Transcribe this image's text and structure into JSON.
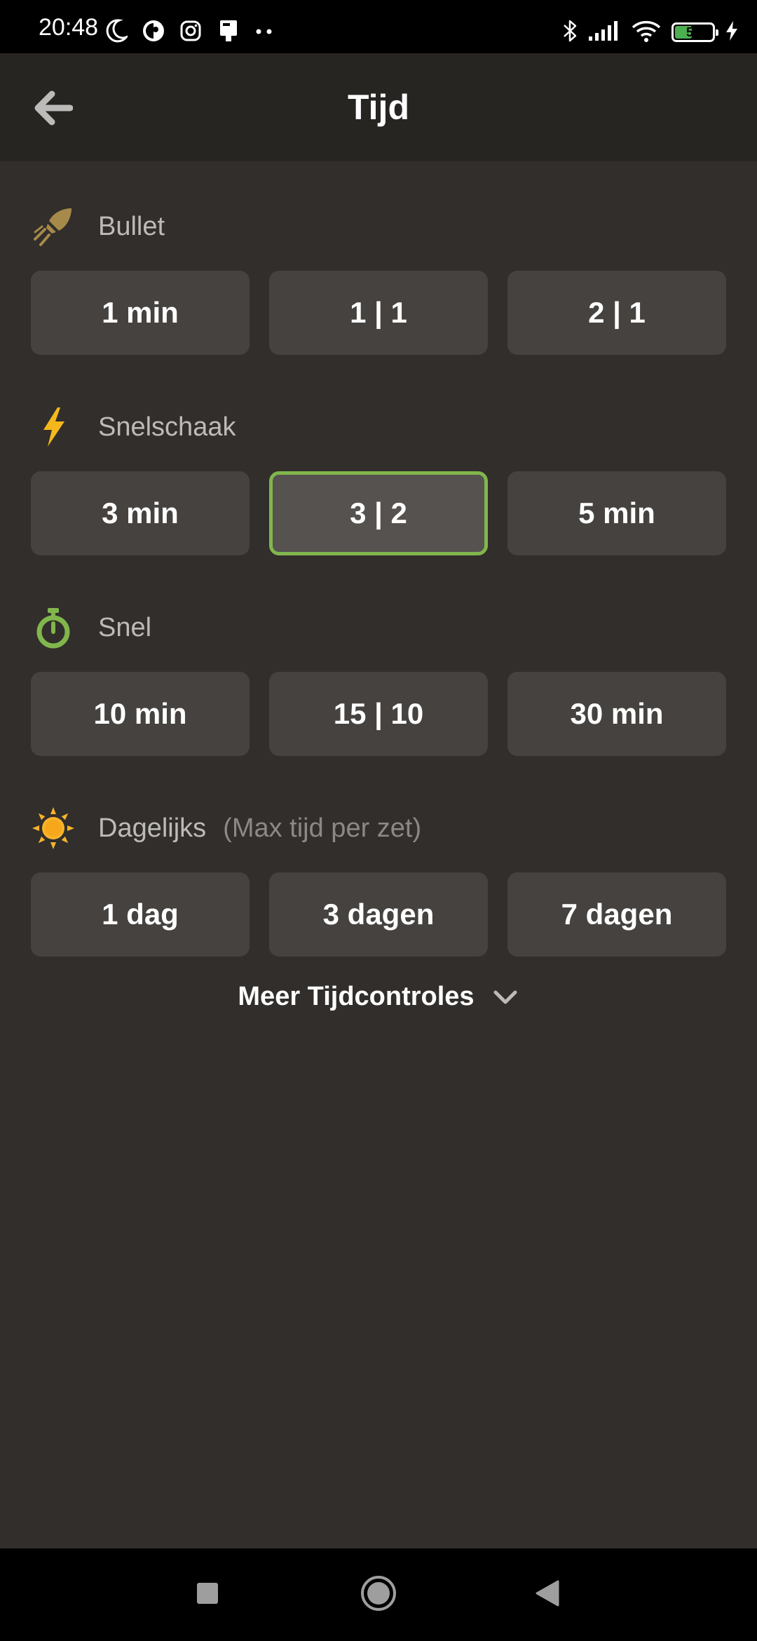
{
  "status_bar": {
    "time": "20:48",
    "battery_level": "50",
    "battery_fraction": 0.5
  },
  "app_bar": {
    "title": "Tijd",
    "back_icon": "arrow-left-icon"
  },
  "sections": [
    {
      "label": "Bullet",
      "note": "",
      "icon": "bullet-icon",
      "icon_color": "#a68a4a",
      "options": [
        "1 min",
        "1 | 1",
        "2 | 1"
      ]
    },
    {
      "label": "Snelschaak",
      "note": "",
      "icon": "lightning-icon",
      "icon_color": "#f5b81c",
      "options": [
        "3 min",
        "3 | 2",
        "5 min"
      ]
    },
    {
      "label": "Snel",
      "note": "",
      "icon": "stopwatch-icon",
      "icon_color": "#81b64c",
      "options": [
        "10 min",
        "15 | 10",
        "30 min"
      ]
    },
    {
      "label": "Dagelijks",
      "note": "(Max tijd per zet)",
      "icon": "sun-icon",
      "icon_color": "#f7b32b",
      "options": [
        "1 dag",
        "3 dagen",
        "7 dagen"
      ]
    }
  ],
  "selected_option": "3 | 2",
  "more_controls": {
    "label": "Meer Tijdcontroles",
    "icon": "chevron-down-icon"
  },
  "colors": {
    "background": "#312e2b",
    "button": "#45423f",
    "selected_border": "#81b64c"
  }
}
